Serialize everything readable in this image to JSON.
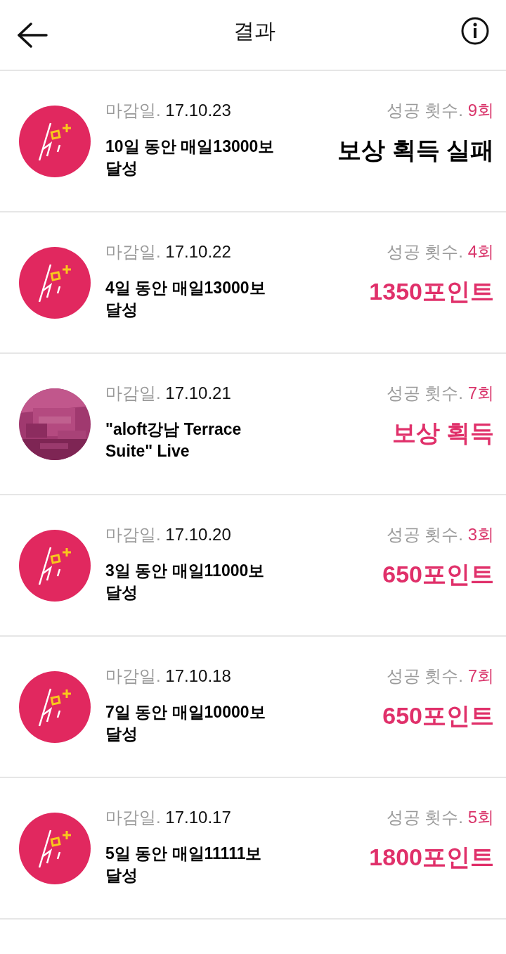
{
  "header": {
    "title": "결과"
  },
  "results": [
    {
      "avatar": {
        "kind": "logo"
      },
      "deadline_label": "마감일.",
      "deadline": "17.10.23",
      "title": "10일 동안 매일13000보 달성",
      "count_label": "성공 횟수.",
      "count": "9회",
      "reward": {
        "text": "보상 획득 실패",
        "kind": "fail"
      }
    },
    {
      "avatar": {
        "kind": "logo"
      },
      "deadline_label": "마감일.",
      "deadline": "17.10.22",
      "title": "4일 동안 매일13000보 달성",
      "count_label": "성공 횟수.",
      "count": "4회",
      "reward": {
        "text": "1350포인트",
        "kind": "success"
      }
    },
    {
      "deadline_label": "마감일.",
      "deadline": "17.10.21",
      "title": "\"aloft강남 Terrace Suite\" Live",
      "count_label": "성공 횟수.",
      "count": "7회",
      "reward": {
        "text": "보상 획득",
        "kind": "success"
      }
    },
    {
      "avatar": {
        "kind": "logo"
      },
      "deadline_label": "마감일.",
      "deadline": "17.10.20",
      "title": "3일 동안 매일11000보 달성",
      "count_label": "성공 횟수.",
      "count": "3회",
      "reward": {
        "text": "650포인트",
        "kind": "success"
      }
    },
    {
      "avatar": {
        "kind": "logo"
      },
      "deadline_label": "마감일.",
      "deadline": "17.10.18",
      "title": "7일 동안 매일10000보 달성",
      "count_label": "성공 횟수.",
      "count": "7회",
      "reward": {
        "text": "650포인트",
        "kind": "success"
      }
    },
    {
      "avatar": {
        "kind": "logo"
      },
      "deadline_label": "마감일.",
      "deadline": "17.10.17",
      "title": "5일 동안 매일11111보 달성",
      "count_label": "성공 횟수.",
      "count": "5회",
      "reward": {
        "text": "1800포인트",
        "kind": "success"
      }
    }
  ]
}
